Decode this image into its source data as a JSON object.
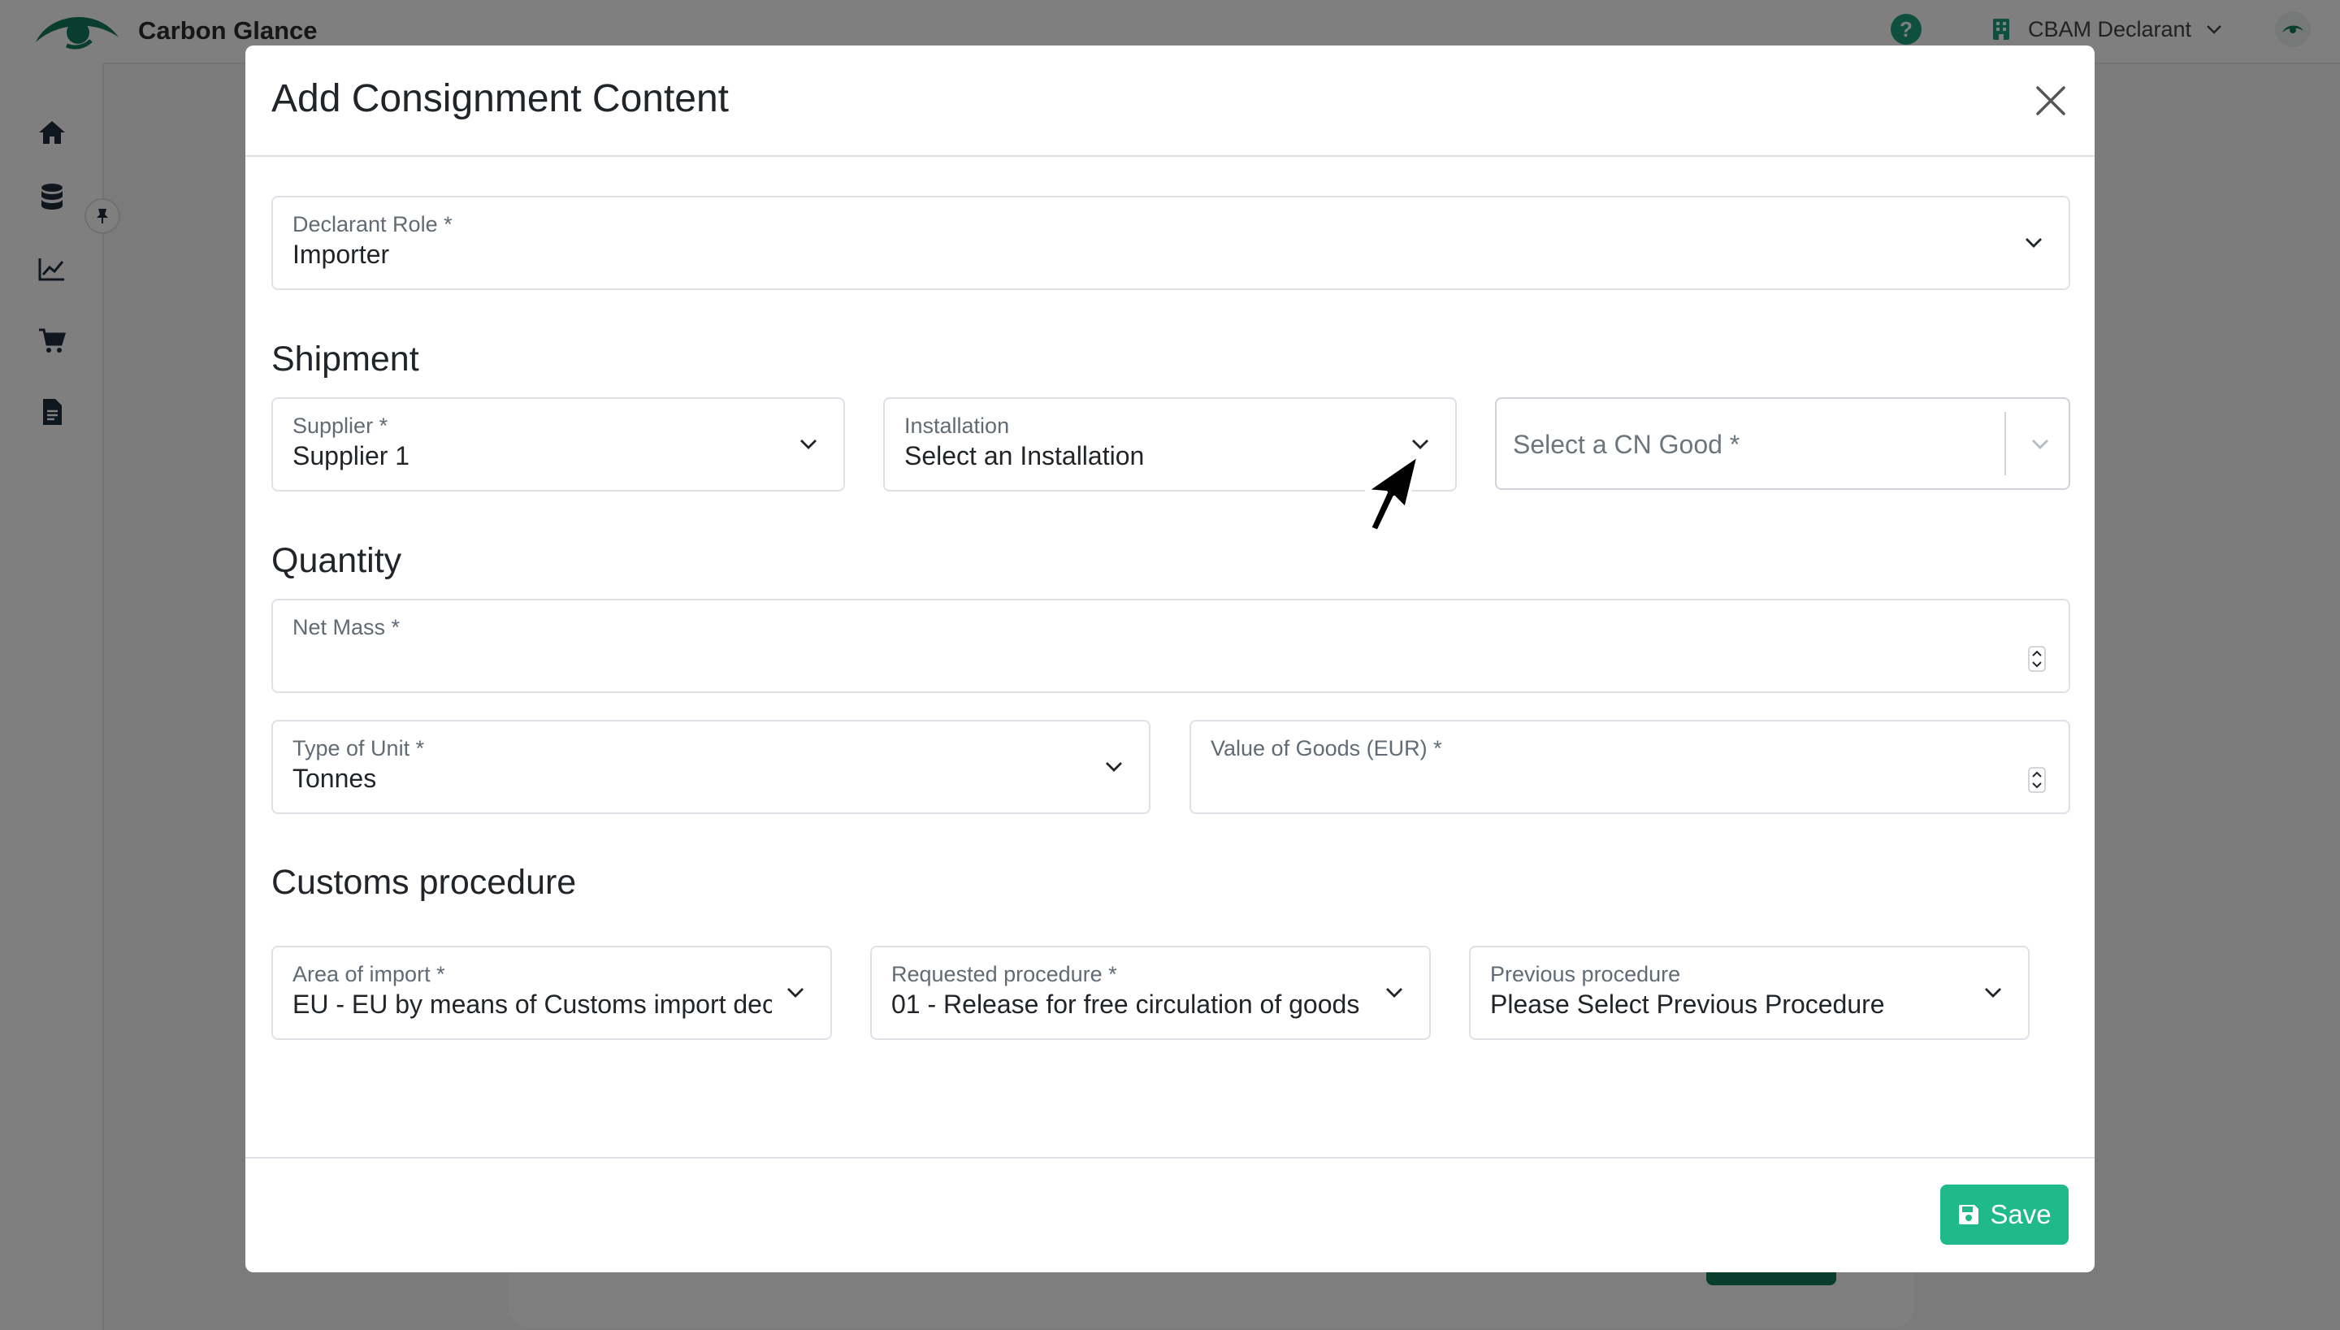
{
  "app": {
    "brand_name": "Carbon Glance",
    "user_label": "CBAM Declarant",
    "brand_color": "#137a5c",
    "accent_color": "#20b98a"
  },
  "sidebar": {
    "icons": [
      "home-icon",
      "database-icon",
      "chart-icon",
      "cart-icon",
      "document-icon"
    ]
  },
  "modal": {
    "title": "Add Consignment Content",
    "declarant_role": {
      "label": "Declarant Role *",
      "value": "Importer"
    },
    "shipment": {
      "title": "Shipment",
      "supplier": {
        "label": "Supplier *",
        "value": "Supplier 1"
      },
      "installation": {
        "label": "Installation",
        "value": "Select an Installation"
      },
      "cn_good": {
        "placeholder": "Select a CN Good *"
      }
    },
    "quantity": {
      "title": "Quantity",
      "net_mass": {
        "label": "Net Mass *",
        "value": ""
      },
      "type_of_unit": {
        "label": "Type of Unit *",
        "value": "Tonnes"
      },
      "value_of_goods": {
        "label": "Value of Goods (EUR) *",
        "value": ""
      }
    },
    "customs": {
      "title": "Customs procedure",
      "area_of_import": {
        "label": "Area of import *",
        "value": "EU - EU by means of Customs import declaration"
      },
      "requested_procedure": {
        "label": "Requested procedure *",
        "value": "01 - Release for free circulation of goods"
      },
      "previous_procedure": {
        "label": "Previous procedure",
        "value": "Please Select Previous Procedure"
      }
    },
    "save_label": "Save"
  }
}
